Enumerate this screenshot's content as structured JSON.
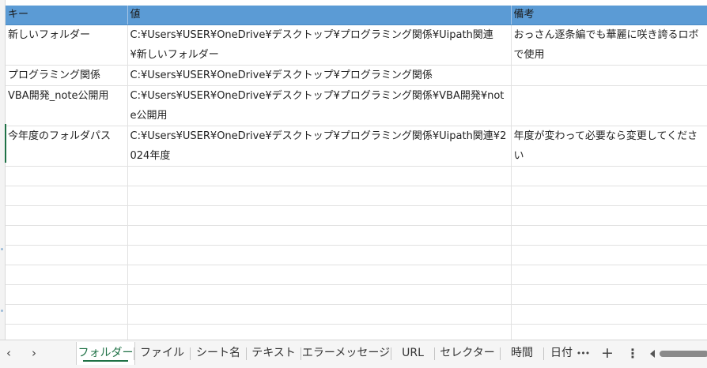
{
  "sheet": {
    "header": [
      "キー",
      "値",
      "備考"
    ],
    "rows": [
      [
        "新しいフォルダー",
        "C:¥Users¥USER¥OneDrive¥デスクトップ¥プログラミング関係¥Uipath関連¥新しいフォルダー",
        "おっさん逐条編でも華麗に咲き誇るロボで使用"
      ],
      [
        "プログラミング関係",
        "C:¥Users¥USER¥OneDrive¥デスクトップ¥プログラミング関係",
        ""
      ],
      [
        "VBA開発_note公開用",
        "C:¥Users¥USER¥OneDrive¥デスクトップ¥プログラミング関係¥VBA開発¥note公開用",
        ""
      ],
      [
        "今年度のフォルダパス",
        "C:¥Users¥USER¥OneDrive¥デスクトップ¥プログラミング関係¥Uipath関連¥2024年度",
        "年度が変わって必要なら変更してください"
      ]
    ]
  },
  "colors": {
    "header_bg": "#5b9bd5",
    "active_tab": "#1e7145"
  },
  "tabbar": {
    "prev_icon": "‹",
    "next_icon": "›",
    "tabs": [
      "フォルダー",
      "ファイル",
      "シート名",
      "テキスト",
      "エラーメッセージ",
      "URL",
      "セレクター",
      "時間",
      "日付"
    ],
    "more_icon": "•••",
    "add_icon": "+",
    "options_icon": "⋮"
  }
}
